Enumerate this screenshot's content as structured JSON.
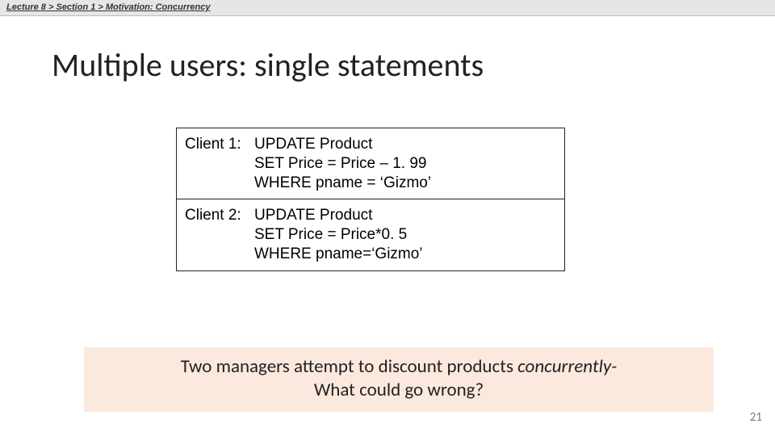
{
  "breadcrumb": {
    "full": "Lecture 8  >  Section 1  >  Motivation: Concurrency"
  },
  "title": "Multiple users: single statements",
  "code": {
    "client1": {
      "label": "Client 1: ",
      "line1": "UPDATE Product",
      "line2": "SET Price = Price – 1. 99",
      "line3": "WHERE pname = ‘Gizmo’"
    },
    "client2": {
      "label": "Client 2: ",
      "line1": "UPDATE Product",
      "line2": "SET Price = Price*0. 5",
      "line3": "WHERE pname=‘Gizmo’"
    }
  },
  "caption": {
    "line1a": "Two managers attempt to discount products ",
    "line1b_em": "concurrently-",
    "line2": "What could go wrong?"
  },
  "page_number": "21"
}
